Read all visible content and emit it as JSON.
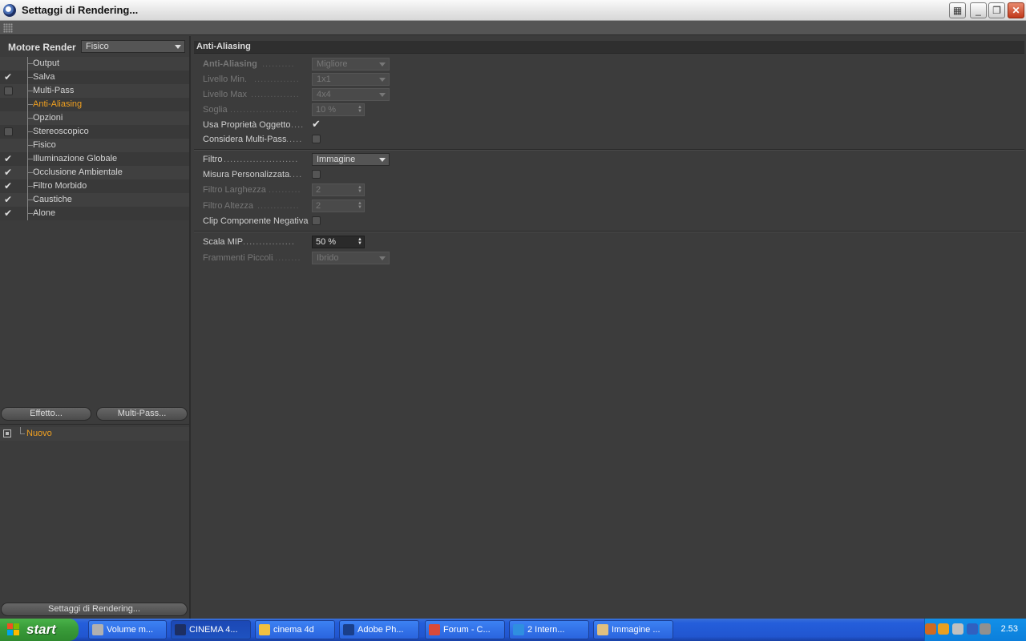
{
  "window": {
    "title": "Settaggi di Rendering..."
  },
  "engine": {
    "label": "Motore Render",
    "value": "Fisico"
  },
  "tree": [
    {
      "label": "Output",
      "check": "none"
    },
    {
      "label": "Salva",
      "check": "tick"
    },
    {
      "label": "Multi-Pass",
      "check": "box"
    },
    {
      "label": "Anti-Aliasing",
      "check": "none",
      "active": true
    },
    {
      "label": "Opzioni",
      "check": "none"
    },
    {
      "label": "Stereoscopico",
      "check": "box"
    },
    {
      "label": "Fisico",
      "check": "none"
    },
    {
      "label": "Illuminazione Globale",
      "check": "tick"
    },
    {
      "label": "Occlusione Ambientale",
      "check": "tick"
    },
    {
      "label": "Filtro Morbido",
      "check": "tick"
    },
    {
      "label": "Caustiche",
      "check": "tick"
    },
    {
      "label": "Alone",
      "check": "tick"
    }
  ],
  "buttons": {
    "effect": "Effetto...",
    "multipass": "Multi-Pass...",
    "render_settings": "Settaggi di Rendering..."
  },
  "new_item": "Nuovo",
  "section": "Anti-Aliasing",
  "fields": {
    "aa": {
      "label": "Anti-Aliasing",
      "value": "Migliore"
    },
    "min_level": {
      "label": "Livello Min.",
      "value": "1x1"
    },
    "max_level": {
      "label": "Livello Max",
      "value": "4x4"
    },
    "threshold": {
      "label": "Soglia",
      "value": "10 %"
    },
    "use_object": {
      "label": "Usa Proprietà Oggetto"
    },
    "consider_mp": {
      "label": "Considera Multi-Pass"
    },
    "filter": {
      "label": "Filtro",
      "value": "Immagine"
    },
    "custom_size": {
      "label": "Misura Personalizzata"
    },
    "filter_width": {
      "label": "Filtro Larghezza",
      "value": "2"
    },
    "filter_height": {
      "label": "Filtro Altezza",
      "value": "2"
    },
    "clip_negative": {
      "label": "Clip Componente Negativa"
    },
    "mip_scale": {
      "label": "Scala MIP",
      "value": "50 %"
    },
    "small_fragments": {
      "label": "Frammenti Piccoli",
      "value": "Ibrido"
    }
  },
  "taskbar": {
    "start": "start",
    "tasks": [
      {
        "label": "Volume m...",
        "color": "#b0b0b0"
      },
      {
        "label": "CINEMA 4...",
        "color": "#1d2f63",
        "active": true
      },
      {
        "label": "cinema 4d",
        "color": "#f0c040"
      },
      {
        "label": "Adobe Ph...",
        "color": "#1a3f8a"
      },
      {
        "label": "Forum - C...",
        "color": "#d94a38"
      },
      {
        "label": "2 Intern...",
        "color": "#2f8fe0"
      },
      {
        "label": "Immagine ...",
        "color": "#e0c080"
      }
    ],
    "clock": "2.53"
  }
}
